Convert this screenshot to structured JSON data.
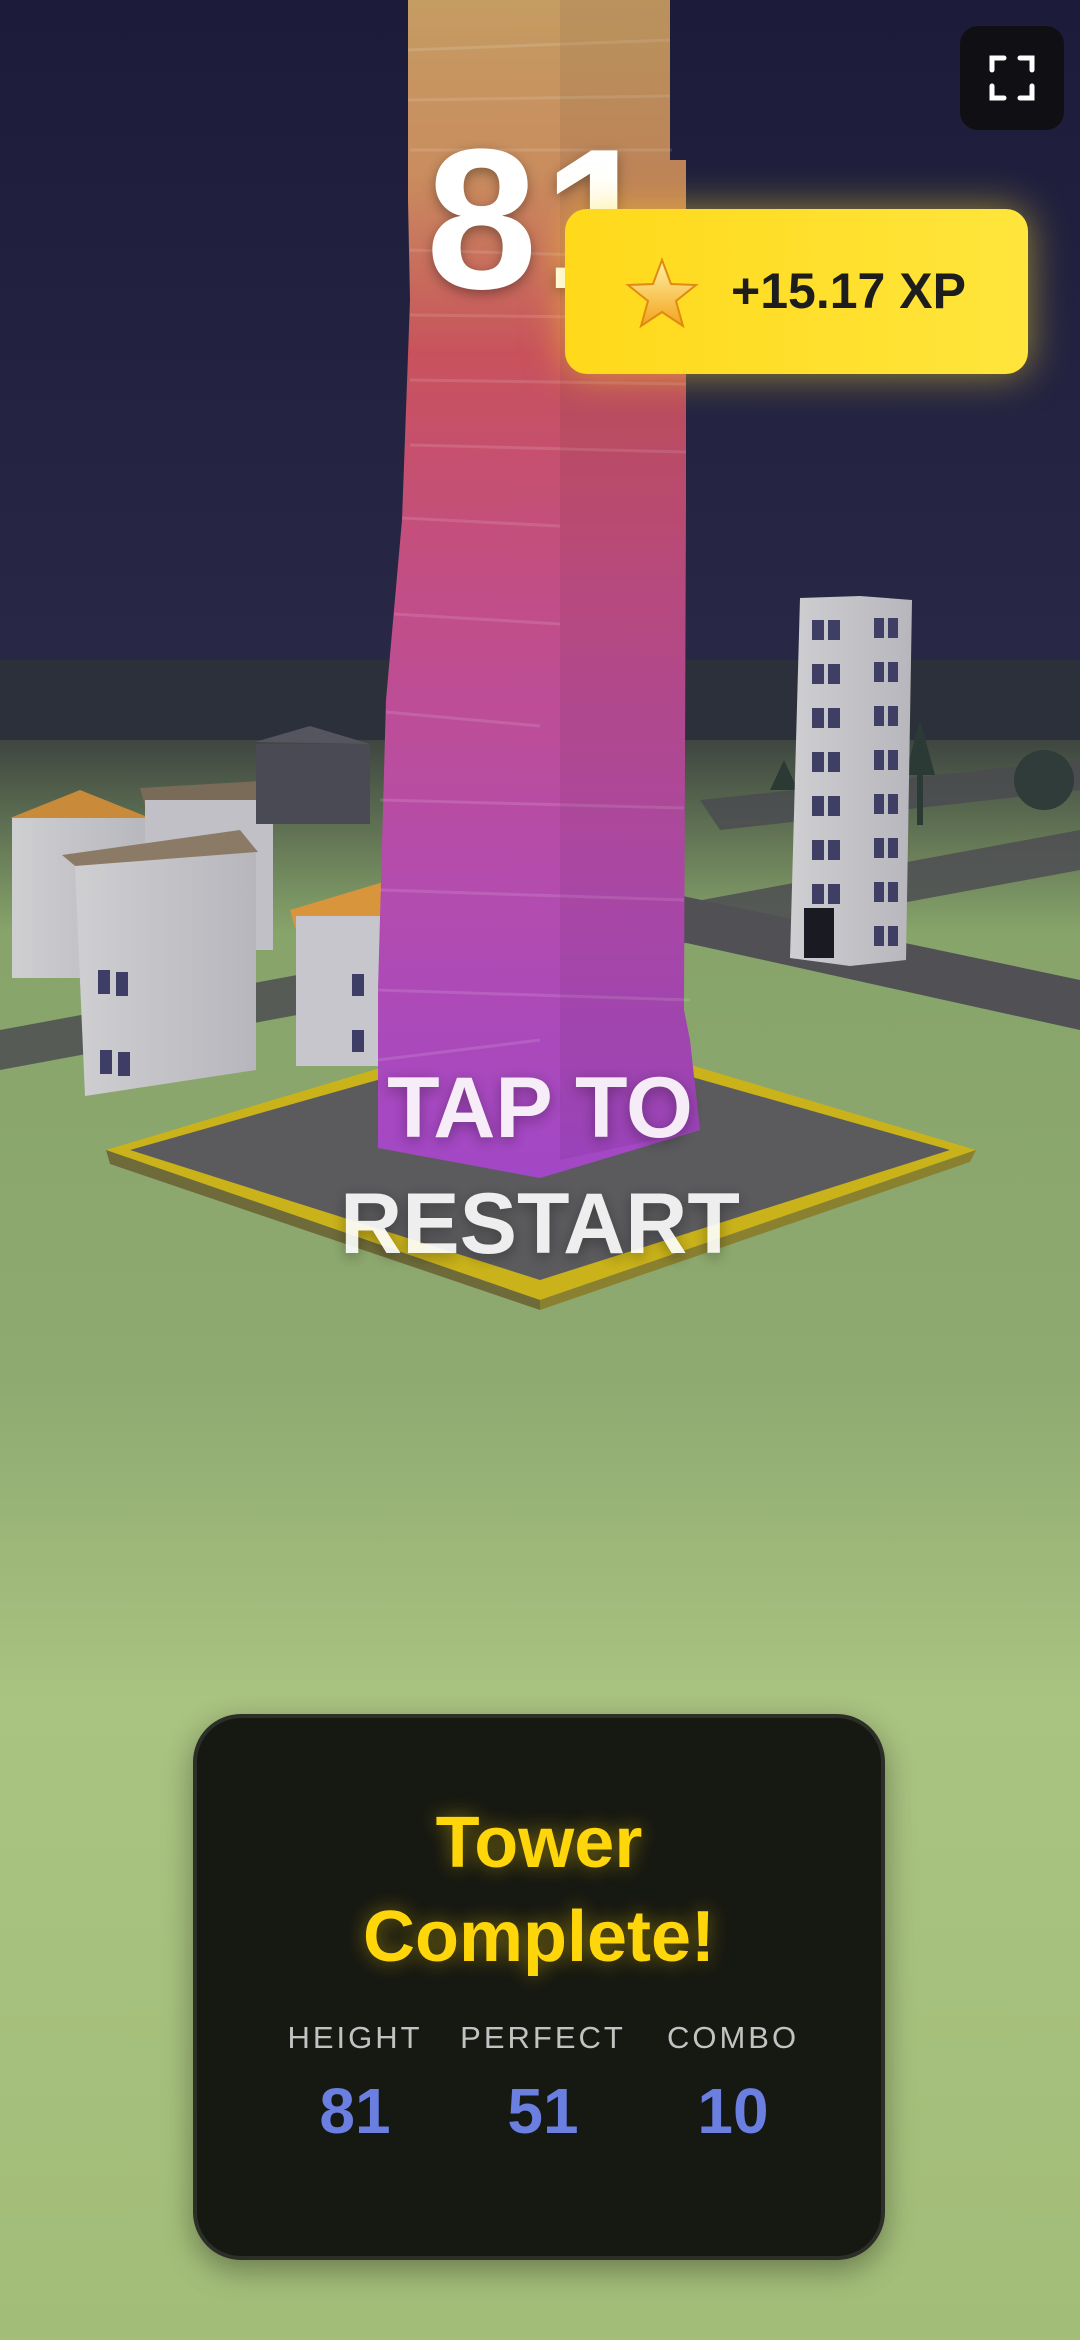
{
  "hud": {
    "score": "81",
    "fullscreen_icon": "fullscreen-icon"
  },
  "xp_toast": {
    "text": "+15.17 XP",
    "icon": "star-icon",
    "color": "#ffe033"
  },
  "prompt": {
    "line1": "TAP TO",
    "line2": "RESTART"
  },
  "result": {
    "title_line1": "Tower",
    "title_line2": "Complete!",
    "title_color": "#ffd60a",
    "stats": [
      {
        "label": "HEIGHT",
        "value": "81"
      },
      {
        "label": "PERFECT",
        "value": "51"
      },
      {
        "label": "COMBO",
        "value": "10"
      }
    ]
  },
  "colors": {
    "sky": "#1e1e3c",
    "grass": "#a6c07c",
    "tower_top": "#c79a5e",
    "tower_mid": "#c9546b",
    "tower_bottom": "#a84cc8",
    "stat_value": "#6b7fe0"
  }
}
